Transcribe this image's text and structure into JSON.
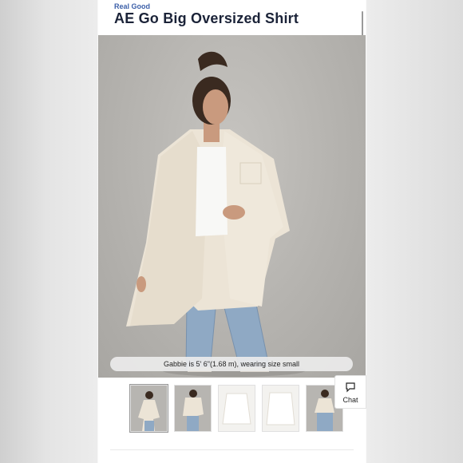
{
  "product": {
    "brand": "Real Good",
    "title": "AE Go Big Oversized Shirt",
    "caption": "Gabbie is 5' 6\"(1.68 m), wearing size small"
  },
  "gallery": {
    "thumbnails": [
      {
        "name": "front-view"
      },
      {
        "name": "back-view"
      },
      {
        "name": "flat-front"
      },
      {
        "name": "flat-back"
      },
      {
        "name": "full-body"
      }
    ]
  },
  "chat": {
    "label": "Chat",
    "icon": "chat-bubble-icon"
  },
  "colors": {
    "title": "#1b2338",
    "brand": "#3b5fa8",
    "shirt": "#ece4d6",
    "jeans": "#8fa9c4"
  }
}
